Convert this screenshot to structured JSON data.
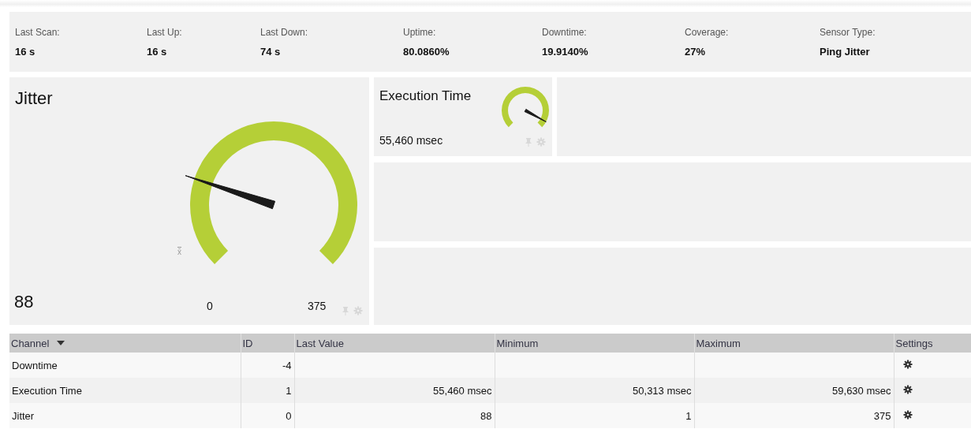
{
  "stats": [
    {
      "label": "Last Scan:",
      "value": "16 s"
    },
    {
      "label": "Last Up:",
      "value": "16 s"
    },
    {
      "label": "Last Down:",
      "value": "74 s"
    },
    {
      "label": "Uptime:",
      "value": "80.0860%"
    },
    {
      "label": "Downtime:",
      "value": "19.9140%"
    },
    {
      "label": "Coverage:",
      "value": "27%"
    },
    {
      "label": "Sensor Type:",
      "value": "Ping Jitter"
    }
  ],
  "main_gauge": {
    "title": "Jitter",
    "value": "88",
    "min": "0",
    "max": "375",
    "mean_label": "x̄",
    "level": 0.235
  },
  "small_gauge": {
    "title": "Execution Time",
    "value": "55,460 msec",
    "level": 0.94
  },
  "table": {
    "columns": [
      "Channel",
      "ID",
      "Last Value",
      "Minimum",
      "Maximum",
      "Settings"
    ],
    "rows": [
      {
        "cells": [
          "Downtime",
          "-4",
          "",
          "",
          ""
        ]
      },
      {
        "cells": [
          "Execution Time",
          "1",
          "55,460 msec",
          "50,313 msec",
          "59,630 msec"
        ]
      },
      {
        "cells": [
          "Jitter",
          "0",
          "88",
          "1",
          "375"
        ]
      }
    ]
  }
}
